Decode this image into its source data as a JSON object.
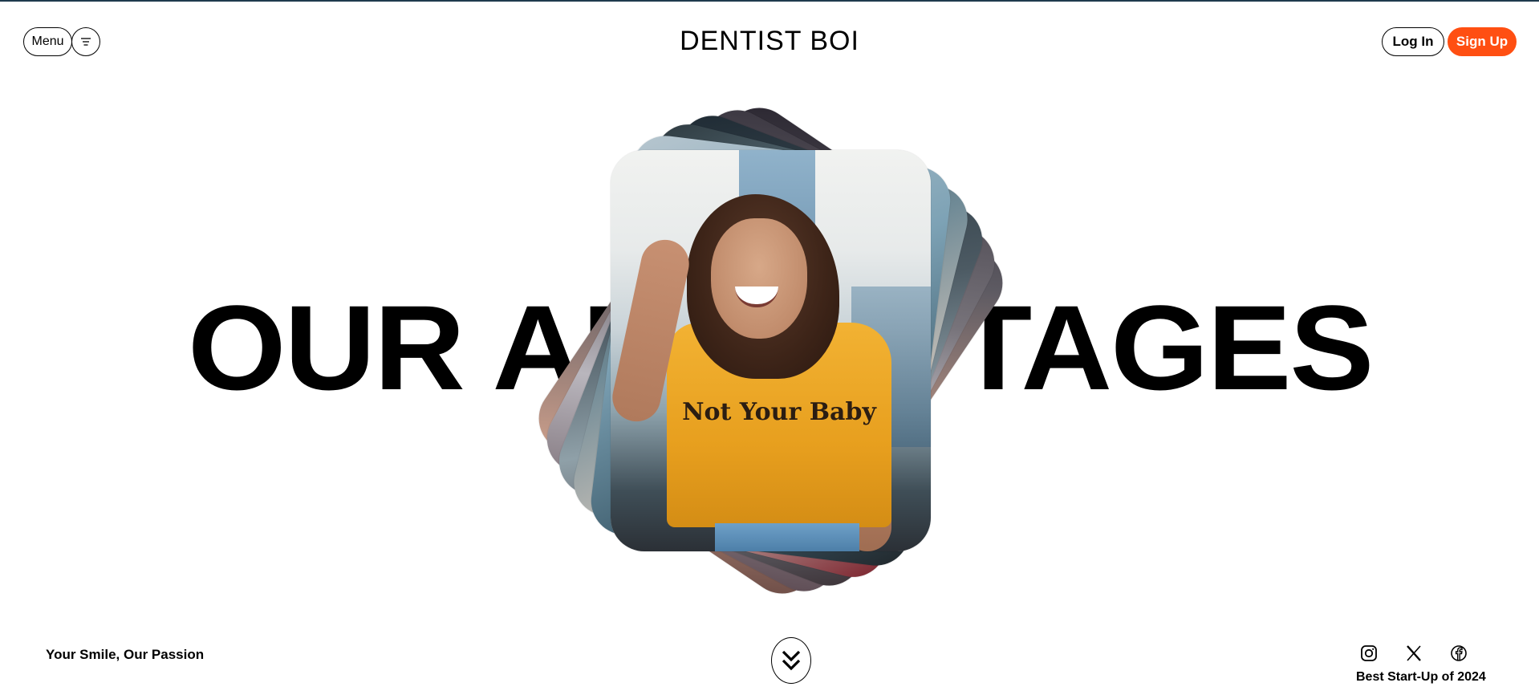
{
  "header": {
    "menu_label": "Menu",
    "menu_icon": "hamburger-icon",
    "logo": "DENTIST BOI",
    "login_label": "Log In",
    "signup_label": "Sign Up"
  },
  "hero": {
    "headline_left": "OUR AD",
    "headline_right": "TAGES",
    "photo_shirt_text": "Not Your Baby"
  },
  "footer": {
    "tagline": "Your Smile, Our Passion",
    "scroll_icon": "double-chevron-down-icon",
    "social": [
      "instagram-icon",
      "x-icon",
      "facebook-icon"
    ],
    "award": "Best Start-Up of 2024"
  },
  "colors": {
    "accent": "#ff4f12",
    "top_rule": "#1f3a4d",
    "text": "#000000",
    "background": "#ffffff"
  }
}
